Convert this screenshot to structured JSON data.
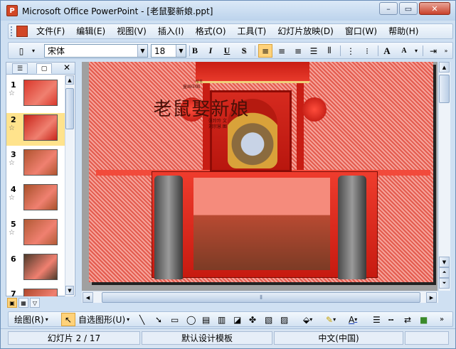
{
  "window": {
    "title": "Microsoft Office PowerPoint - [老鼠娶新娘.ppt]"
  },
  "window_controls": {
    "minimize": "–",
    "restore": "▭",
    "close": "✕"
  },
  "menu": {
    "items": [
      {
        "label": "文件(F)"
      },
      {
        "label": "编辑(E)"
      },
      {
        "label": "视图(V)"
      },
      {
        "label": "插入(I)"
      },
      {
        "label": "格式(O)"
      },
      {
        "label": "工具(T)"
      },
      {
        "label": "幻灯片放映(D)"
      },
      {
        "label": "窗口(W)"
      },
      {
        "label": "帮助(H)"
      }
    ]
  },
  "formatting": {
    "font_name": "宋体",
    "font_size": "18",
    "bold": "B",
    "italic": "I",
    "underline": "U",
    "shadow": "S",
    "grow_font": "A",
    "shrink_font": "A"
  },
  "outline_pane": {
    "close": "✕",
    "slides": [
      {
        "number": "1",
        "selected": false,
        "color": "#d9372b"
      },
      {
        "number": "2",
        "selected": true,
        "color": "#c8251a"
      },
      {
        "number": "3",
        "selected": false,
        "color": "#b0542f"
      },
      {
        "number": "4",
        "selected": false,
        "color": "#a8502a"
      },
      {
        "number": "5",
        "selected": false,
        "color": "#b25a35"
      },
      {
        "number": "6",
        "selected": false,
        "color": "#4e3a2a"
      },
      {
        "number": "7",
        "selected": false,
        "color": "#b0472c"
      }
    ]
  },
  "slide": {
    "book_title": "老鼠娶新娘",
    "series": "绘本",
    "subtitle": "童画中国",
    "author_lines": [
      "张玲玲  文",
      "刘宗慧  图"
    ]
  },
  "drawing_toolbar": {
    "draw_label": "绘图(R)",
    "autoshapes_label": "自选图形(U)"
  },
  "status": {
    "slide_info": "幻灯片 2 / 17",
    "design": "默认设计模板",
    "language": "中文(中国)"
  }
}
